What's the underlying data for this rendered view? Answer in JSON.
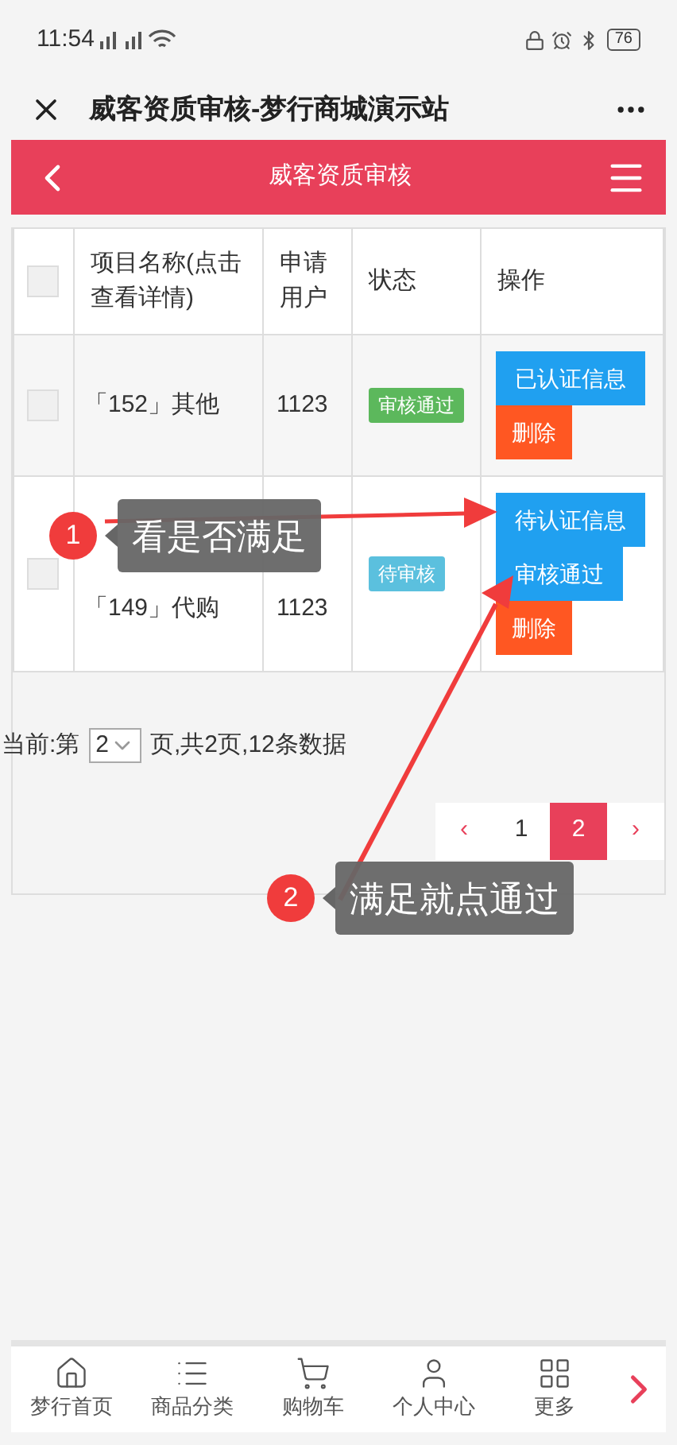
{
  "status_bar": {
    "time": "11:54",
    "battery": "76"
  },
  "browser_bar": {
    "title": "威客资质审核-梦行商城演示站"
  },
  "header": {
    "title": "威客资质审核"
  },
  "table": {
    "select_all": {
      "checked": false
    },
    "columns": [
      "项目名称(点击查看详情)",
      "申请用户",
      "状态",
      "操作"
    ],
    "rows": [
      {
        "checked": false,
        "name": "「152」其他",
        "user": "1123",
        "status": {
          "kind": "approved",
          "label": "审核通过"
        },
        "actions": [
          {
            "kind": "info",
            "label": "已认证信息"
          },
          {
            "kind": "delete",
            "label": "删除"
          }
        ]
      },
      {
        "checked": false,
        "name": "「149」代购",
        "user": "1123",
        "status": {
          "kind": "pending",
          "label": "待审核"
        },
        "actions": [
          {
            "kind": "info",
            "label": "待认证信息"
          },
          {
            "kind": "info",
            "label": "审核通过"
          },
          {
            "kind": "delete",
            "label": "删除"
          }
        ]
      }
    ]
  },
  "pagination": {
    "prefix": "当前:第",
    "page_select": "2",
    "suffix": "页,共2页,12条数据",
    "pages": [
      {
        "label": "‹",
        "kind": "prev",
        "selected": false
      },
      {
        "label": "1",
        "kind": "page",
        "selected": false
      },
      {
        "label": "2",
        "kind": "page",
        "selected": true
      },
      {
        "label": "›",
        "kind": "next",
        "selected": false
      }
    ]
  },
  "callouts": [
    {
      "number": "1",
      "text": "看是否满足"
    },
    {
      "number": "2",
      "text": "满足就点通过"
    }
  ],
  "bottom_nav": [
    {
      "label": "梦行首页"
    },
    {
      "label": "商品分类"
    },
    {
      "label": "购物车"
    },
    {
      "label": "个人中心"
    },
    {
      "label": "更多"
    }
  ]
}
